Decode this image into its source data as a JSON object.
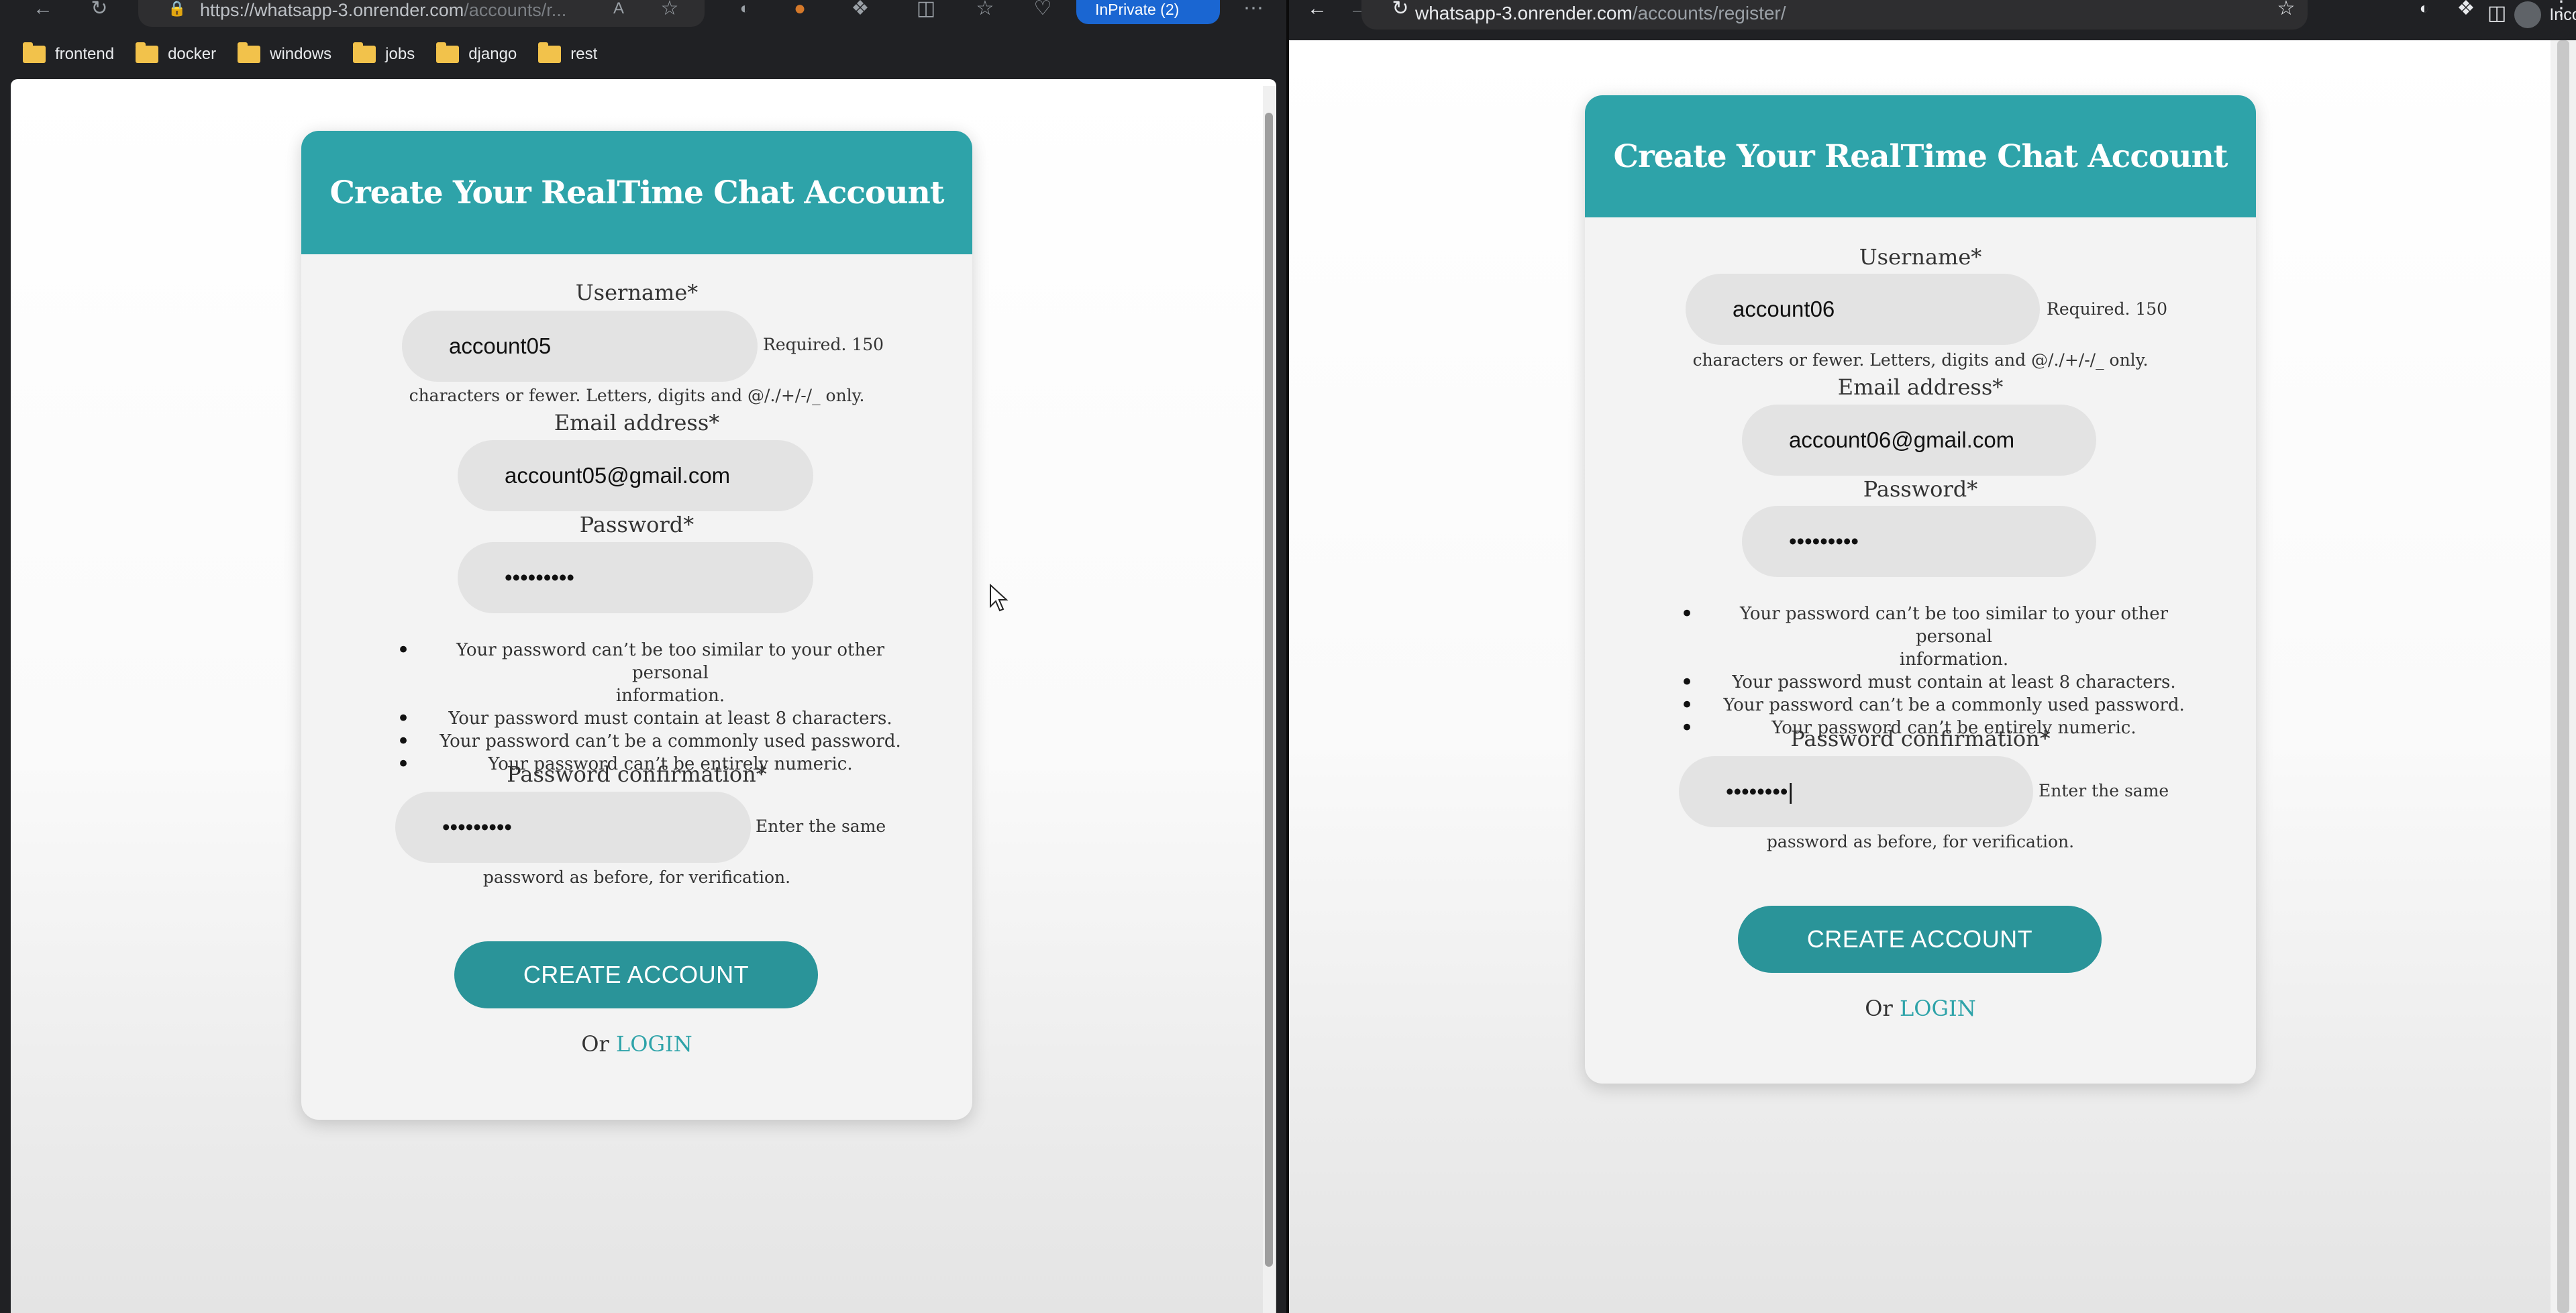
{
  "left_window": {
    "browser": "edge",
    "address": {
      "host": "https://whatsapp-3.onrender.com",
      "path": "/accounts/r..."
    },
    "inprivate_label": "InPrivate (2)",
    "bookmarks": [
      "frontend",
      "docker",
      "windows",
      "jobs",
      "django",
      "rest"
    ],
    "form": {
      "title": "Create Your RealTime Chat Account",
      "username_label": "Username*",
      "username_value": "account05",
      "username_help_a": "Required. 150",
      "username_help_b": "characters or fewer. Letters, digits and @/./+/-/_ only.",
      "email_label": "Email address*",
      "email_value": "account05@gmail.com",
      "password_label": "Password*",
      "password_value": "•••••••••",
      "password_rules": [
        "Your password can’t be too similar to your other personal",
        "information.",
        "Your password must contain at least 8 characters.",
        "Your password can’t be a commonly used password.",
        "Your password can’t be entirely numeric."
      ],
      "confirm_label": "Password confirmation*",
      "confirm_value": "•••••••••",
      "confirm_help_a": "Enter the same",
      "confirm_help_b": "password as before, for verification.",
      "submit_label": "CREATE ACCOUNT",
      "or_text": "Or",
      "login_link": "LOGIN"
    }
  },
  "right_window": {
    "browser": "chrome",
    "address": {
      "host": "whatsapp-3.onrender.com",
      "path": "/accounts/register/"
    },
    "incognito_label": "Incognito",
    "form": {
      "title": "Create Your RealTime Chat Account",
      "username_label": "Username*",
      "username_value": "account06",
      "username_help_a": "Required. 150",
      "username_help_b": "characters or fewer. Letters, digits and @/./+/-/_ only.",
      "email_label": "Email address*",
      "email_value": "account06@gmail.com",
      "password_label": "Password*",
      "password_value": "•••••••••",
      "password_rules": [
        "Your password can’t be too similar to your other personal",
        "information.",
        "Your password must contain at least 8 characters.",
        "Your password can’t be a commonly used password.",
        "Your password can’t be entirely numeric."
      ],
      "confirm_label": "Password confirmation*",
      "confirm_value": "••••••••|",
      "confirm_help_a": "Enter the same",
      "confirm_help_b": "password as before, for verification.",
      "submit_label": "CREATE ACCOUNT",
      "or_text": "Or",
      "login_link": "LOGIN"
    }
  },
  "colors": {
    "header_teal": "#2ea3a9",
    "button_teal": "#2a9499",
    "edge_private_blue": "#1a66d2"
  }
}
